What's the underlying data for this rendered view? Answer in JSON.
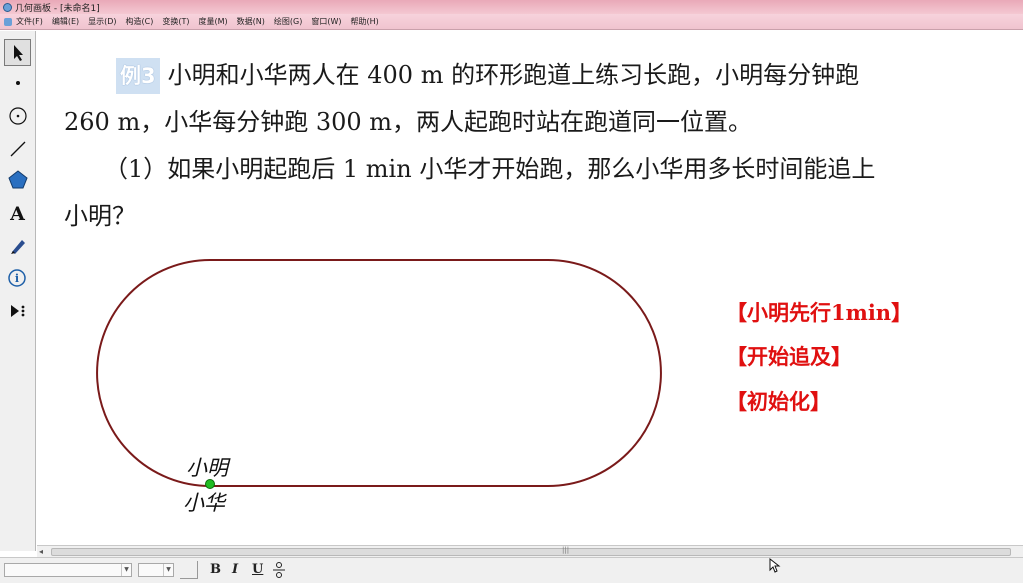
{
  "window": {
    "title": "几何画板 - [未命名1]"
  },
  "menu": [
    "文件(F)",
    "编辑(E)",
    "显示(D)",
    "构造(C)",
    "变换(T)",
    "度量(M)",
    "数据(N)",
    "绘图(G)",
    "窗口(W)",
    "帮助(H)"
  ],
  "toolbox": [
    {
      "name": "arrow-select-tool-icon"
    },
    {
      "name": "point-tool-icon"
    },
    {
      "name": "compass-tool-icon"
    },
    {
      "name": "straightedge-tool-icon"
    },
    {
      "name": "polygon-tool-icon"
    },
    {
      "name": "text-tool-icon",
      "glyph": "A"
    },
    {
      "name": "marker-tool-icon"
    },
    {
      "name": "information-tool-icon",
      "glyph": "i"
    },
    {
      "name": "custom-tool-icon"
    }
  ],
  "problem": {
    "badge": "例3",
    "line1": "小明和小华两人在 400 m 的环形跑道上练习长跑，小明每分钟跑",
    "line2": "260 m，小华每分钟跑 300 m，两人起跑时站在跑道同一位置。",
    "line3": "（1）如果小明起跑后 1 min 小华才开始跑，那么小华用多长时间能追上",
    "line4": "小明？"
  },
  "runners": {
    "xiaoming": "小明",
    "xiaohua": "小华"
  },
  "buttons": {
    "lead": "【小明先行1min】",
    "chase": "【开始追及】",
    "reset": "【初始化】"
  },
  "format": {
    "bold": "B",
    "italic": "I",
    "underline": "U"
  },
  "colors": {
    "track": "#7a1a1a",
    "point": "#22bb22",
    "buttons": "#e01010",
    "badge": "#cfe0f2"
  }
}
